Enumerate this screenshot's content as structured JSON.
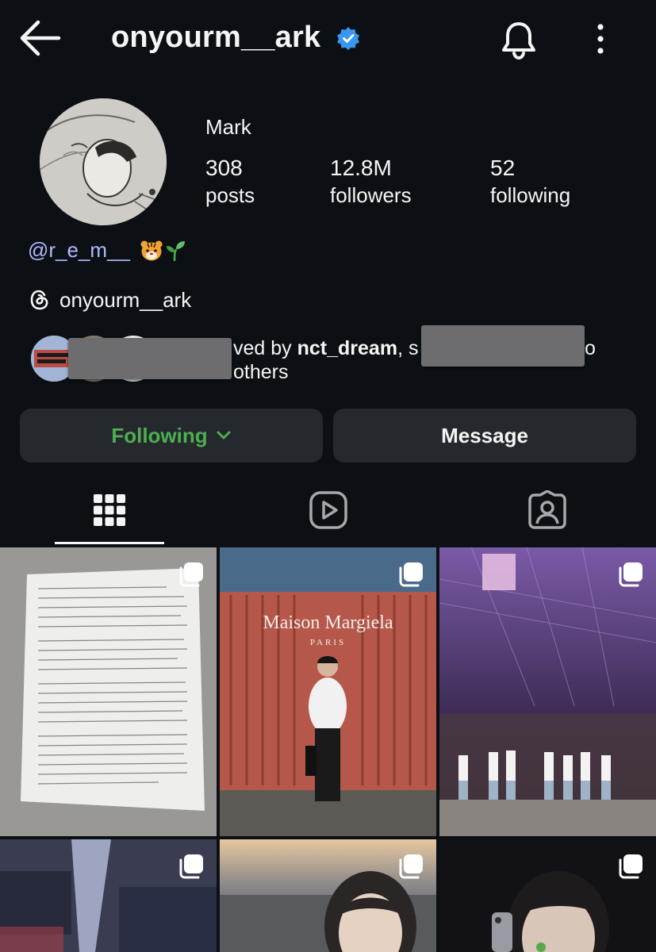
{
  "header": {
    "username": "onyourm__ark",
    "verified": true,
    "icons": {
      "back": "arrow-left-icon",
      "notifications": "bell-icon",
      "more": "more-vertical-icon",
      "verified": "verified-badge-icon"
    }
  },
  "profile": {
    "display_name": "Mark",
    "stats": {
      "posts": {
        "count": "308",
        "label": "posts"
      },
      "followers": {
        "count": "12.8M",
        "label": "followers"
      },
      "following": {
        "count": "52",
        "label": "following"
      }
    },
    "bio_mention": "@r_e_m__",
    "bio_emojis": [
      "tiger-face",
      "seedling"
    ],
    "threads_handle": "onyourm__ark",
    "mutual": {
      "prefix": "ved by ",
      "bold_name": "nct_dream",
      "middle": ", s",
      "trailing": "o",
      "second_line": "others"
    }
  },
  "actions": {
    "following_label": "Following",
    "message_label": "Message"
  },
  "tabs": [
    {
      "name": "posts-grid",
      "icon": "grid-icon",
      "active": true
    },
    {
      "name": "reels",
      "icon": "reels-icon",
      "active": false
    },
    {
      "name": "tagged",
      "icon": "tagged-person-icon",
      "active": false
    }
  ],
  "grid_posts": [
    {
      "subject": "handwritten letter",
      "multiple": true
    },
    {
      "subject": "Maison Margiela container",
      "overlay_title": "Maison Margiela",
      "overlay_subtitle": "PARIS",
      "multiple": true
    },
    {
      "subject": "concert stage",
      "multiple": true
    },
    {
      "subject": "blurred interior",
      "multiple": true
    },
    {
      "subject": "portrait outdoors",
      "multiple": true
    },
    {
      "subject": "selfie with microphone",
      "multiple": true
    }
  ],
  "colors": {
    "background": "#0c1014",
    "text": "#f5f5f5",
    "following_green": "#4caf50",
    "mention_blue": "#b0b9ff",
    "button_bg": "#25292e",
    "verified_blue": "#3897f0"
  }
}
